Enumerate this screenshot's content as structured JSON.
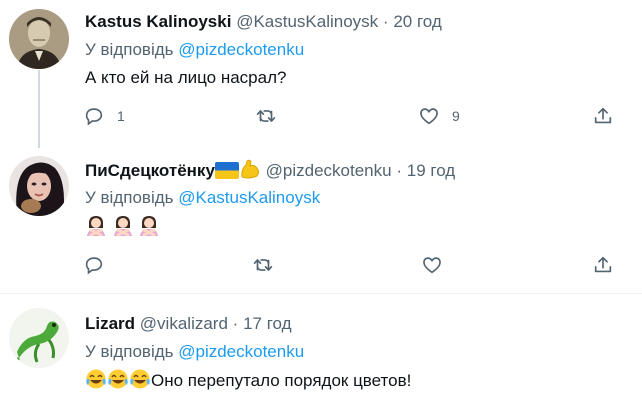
{
  "tweets": [
    {
      "name": "Kastus Kalinoyski",
      "handle": "@KastusKalinoysk",
      "separator": "·",
      "time": "20 год",
      "reply_prefix": "У відповідь",
      "reply_mention": "@pizdeckotenku",
      "text": "А кто ей на лицо насрал?",
      "reply_count": "1",
      "retweet_count": "",
      "like_count": "9"
    },
    {
      "name": "ПиСдецкотёнку",
      "handle": "@pizdeckotenku",
      "separator": "·",
      "time": "19 год",
      "reply_prefix": "У відповідь",
      "reply_mention": "@KastusKalinoysk",
      "text": "",
      "reply_count": "",
      "retweet_count": "",
      "like_count": ""
    },
    {
      "name": "Lizard",
      "handle": "@vikalizard",
      "separator": "·",
      "time": "17 год",
      "reply_prefix": "У відповідь",
      "reply_mention": "@pizdeckotenku",
      "text": "Оно перепутало порядок цветов!"
    }
  ],
  "colors": {
    "accent": "#1d9bf0",
    "secondary_text": "#536471",
    "thread_line": "#cfd9de"
  },
  "icons": [
    "reply-icon",
    "retweet-icon",
    "like-icon",
    "share-icon",
    "ukraine-flag-icon",
    "flexed-biceps-icon",
    "woman-gesturing-no-icon",
    "face-with-tears-of-joy-icon"
  ]
}
